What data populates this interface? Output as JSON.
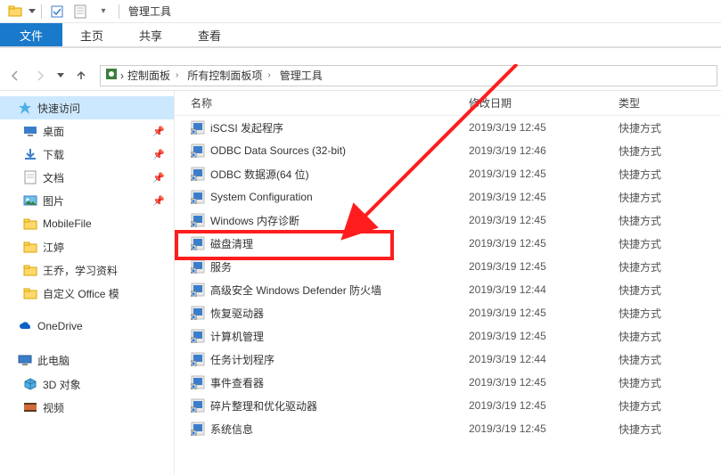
{
  "window": {
    "title": "管理工具"
  },
  "ribbon": {
    "tabs": {
      "file": "文件",
      "home": "主页",
      "share": "共享",
      "view": "查看"
    }
  },
  "breadcrumbs": [
    "控制面板",
    "所有控制面板项",
    "管理工具"
  ],
  "nav": {
    "quick_access": "快速访问",
    "items": [
      {
        "label": "桌面",
        "icon": "desktop",
        "pinned": true
      },
      {
        "label": "下载",
        "icon": "download",
        "pinned": true
      },
      {
        "label": "文档",
        "icon": "document",
        "pinned": true
      },
      {
        "label": "图片",
        "icon": "picture",
        "pinned": true
      },
      {
        "label": "MobileFile",
        "icon": "folder",
        "pinned": false
      },
      {
        "label": "江婷",
        "icon": "folder",
        "pinned": false
      },
      {
        "label": "王乔，学习资料",
        "icon": "folder",
        "pinned": false
      },
      {
        "label": "自定义 Office 模",
        "icon": "folder",
        "pinned": false
      }
    ],
    "onedrive": "OneDrive",
    "this_pc": "此电脑",
    "pc_items": [
      {
        "label": "3D 对象",
        "icon": "3d"
      },
      {
        "label": "视频",
        "icon": "video"
      }
    ]
  },
  "columns": {
    "name": "名称",
    "date": "修改日期",
    "type": "类型"
  },
  "rows": [
    {
      "name": "iSCSI 发起程序",
      "date": "2019/3/19 12:45",
      "type": "快捷方式"
    },
    {
      "name": "ODBC Data Sources (32-bit)",
      "date": "2019/3/19 12:46",
      "type": "快捷方式"
    },
    {
      "name": "ODBC 数据源(64 位)",
      "date": "2019/3/19 12:45",
      "type": "快捷方式"
    },
    {
      "name": "System Configuration",
      "date": "2019/3/19 12:45",
      "type": "快捷方式"
    },
    {
      "name": "Windows 内存诊断",
      "date": "2019/3/19 12:45",
      "type": "快捷方式"
    },
    {
      "name": "磁盘清理",
      "date": "2019/3/19 12:45",
      "type": "快捷方式"
    },
    {
      "name": "服务",
      "date": "2019/3/19 12:45",
      "type": "快捷方式"
    },
    {
      "name": "高级安全 Windows Defender 防火墙",
      "date": "2019/3/19 12:44",
      "type": "快捷方式"
    },
    {
      "name": "恢复驱动器",
      "date": "2019/3/19 12:45",
      "type": "快捷方式"
    },
    {
      "name": "计算机管理",
      "date": "2019/3/19 12:45",
      "type": "快捷方式"
    },
    {
      "name": "任务计划程序",
      "date": "2019/3/19 12:44",
      "type": "快捷方式"
    },
    {
      "name": "事件查看器",
      "date": "2019/3/19 12:45",
      "type": "快捷方式"
    },
    {
      "name": "碎片整理和优化驱动器",
      "date": "2019/3/19 12:45",
      "type": "快捷方式"
    },
    {
      "name": "系统信息",
      "date": "2019/3/19 12:45",
      "type": "快捷方式"
    }
  ],
  "highlighted_row_index": 4
}
